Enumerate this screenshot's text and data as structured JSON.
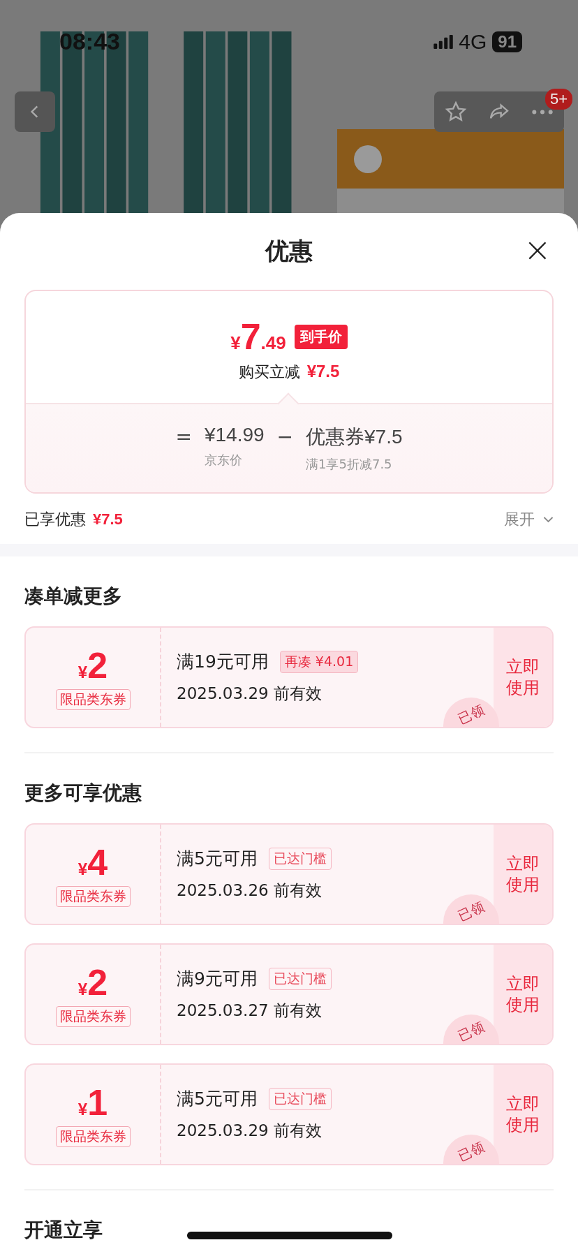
{
  "status_bar": {
    "time": "08:43",
    "network": "4G",
    "battery": "91"
  },
  "product_header": {
    "kind": "picture",
    "badge": "5+"
  },
  "sheet": {
    "title": "优惠",
    "close": "×"
  },
  "price_card": {
    "currency": "¥",
    "integer": "7",
    "decimal": ".49",
    "price_tag": "到手价",
    "saving_label": "购买立减",
    "saving_value": "¥7.5",
    "equals": "=",
    "base_price": "¥14.99",
    "base_label": "京东价",
    "minus": "−",
    "coupon_value": "优惠券¥7.5",
    "coupon_rule": "满1享5折减7.5"
  },
  "enjoyed": {
    "label": "已享优惠",
    "value": "¥7.5",
    "expand": "展开",
    "expanded": false
  },
  "sections": [
    {
      "title": "凑单减更多",
      "coupons": [
        {
          "currency": "¥",
          "amount": "2",
          "type_label": "限品类东券",
          "condition": "满19元可用",
          "tag": {
            "text": "再凑 ¥4.01",
            "kind": "shortfall"
          },
          "expiry": "2025.03.29 前有效",
          "action": "立即使用",
          "stamp": "已领"
        }
      ]
    },
    {
      "title": "更多可享优惠",
      "coupons": [
        {
          "currency": "¥",
          "amount": "4",
          "type_label": "限品类东券",
          "condition": "满5元可用",
          "tag": {
            "text": "已达门槛",
            "kind": "reached"
          },
          "expiry": "2025.03.26 前有效",
          "action": "立即使用",
          "stamp": "已领"
        },
        {
          "currency": "¥",
          "amount": "2",
          "type_label": "限品类东券",
          "condition": "满9元可用",
          "tag": {
            "text": "已达门槛",
            "kind": "reached"
          },
          "expiry": "2025.03.27 前有效",
          "action": "立即使用",
          "stamp": "已领"
        },
        {
          "currency": "¥",
          "amount": "1",
          "type_label": "限品类东券",
          "condition": "满5元可用",
          "tag": {
            "text": "已达门槛",
            "kind": "reached"
          },
          "expiry": "2025.03.29 前有效",
          "action": "立即使用",
          "stamp": "已领"
        }
      ]
    },
    {
      "title": "开通立享"
    }
  ]
}
